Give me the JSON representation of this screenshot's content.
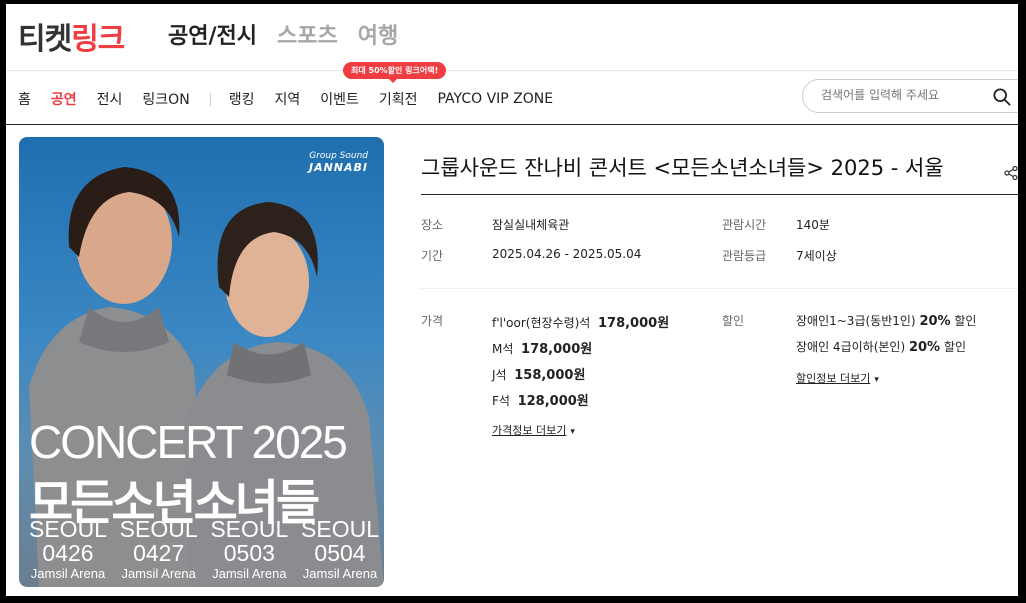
{
  "header": {
    "logo_part1": "티켓",
    "logo_part2": "링크",
    "categories": [
      "공연/전시",
      "스포츠",
      "여행"
    ]
  },
  "nav": {
    "items": [
      "홈",
      "공연",
      "전시",
      "링크ON",
      "랭킹",
      "지역",
      "이벤트",
      "기획전",
      "PAYCO VIP ZONE"
    ],
    "promo_badge": "최대 50%할인 링크어택!"
  },
  "search": {
    "placeholder": "검색어를 입력해 주세요"
  },
  "poster": {
    "brand_top": "Group Sound",
    "brand_name": "JANNABI",
    "concert": "CONCERT 2025",
    "title": "모든소년소녀들",
    "dates": [
      {
        "city": "SEOUL",
        "date": "0426",
        "venue": "Jamsil Arena"
      },
      {
        "city": "SEOUL",
        "date": "0427",
        "venue": "Jamsil Arena"
      },
      {
        "city": "SEOUL",
        "date": "0503",
        "venue": "Jamsil Arena"
      },
      {
        "city": "SEOUL",
        "date": "0504",
        "venue": "Jamsil Arena"
      }
    ]
  },
  "event": {
    "title": "그룹사운드 잔나비 콘서트 <모든소년소녀들> 2025 - 서울",
    "venue_label": "장소",
    "venue": "잠실실내체육관",
    "period_label": "기간",
    "period": "2025.04.26 - 2025.05.04",
    "runtime_label": "관람시간",
    "runtime": "140분",
    "age_label": "관람등급",
    "age": "7세이상",
    "price_label": "가격",
    "prices": [
      {
        "seat": "f'l'oor(현장수령)석",
        "price": "178,000원"
      },
      {
        "seat": "M석",
        "price": "178,000원"
      },
      {
        "seat": "J석",
        "price": "158,000원"
      },
      {
        "seat": "F석",
        "price": "128,000원"
      }
    ],
    "price_more": "가격정보 더보기",
    "discount_label": "할인",
    "discounts": [
      {
        "target": "장애인1~3급(동반1인)",
        "rate": "20%",
        "suffix": "할인"
      },
      {
        "target": "장애인 4급이하(본인)",
        "rate": "20%",
        "suffix": "할인"
      }
    ],
    "discount_more": "할인정보 더보기"
  },
  "colors": {
    "accent": "#ef3e42",
    "text": "#222222",
    "muted": "#a7a7a7"
  }
}
